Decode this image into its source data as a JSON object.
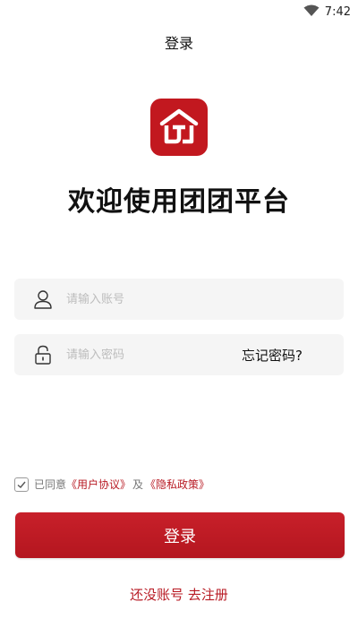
{
  "status_bar": {
    "time": "7:42",
    "icons": [
      "wifi-icon",
      "battery-icon"
    ]
  },
  "header": {
    "title": "登录"
  },
  "logo": {
    "icon": "house-logo-icon",
    "color": "#c2181f"
  },
  "welcome": {
    "title": "欢迎使用团团平台"
  },
  "form": {
    "account": {
      "placeholder": "请输入账号",
      "value": "",
      "icon": "user-icon"
    },
    "password": {
      "placeholder": "请输入密码",
      "value": "",
      "icon": "lock-icon"
    },
    "forgot_label": "忘记密码?"
  },
  "agreement": {
    "checked": true,
    "prefix": "已同意",
    "user_agreement": "《用户协议》",
    "and": "及",
    "privacy_policy": "《隐私政策》"
  },
  "login_button": {
    "label": "登录"
  },
  "register": {
    "label": "还没账号 去注册"
  },
  "colors": {
    "accent": "#b81b24",
    "field_bg": "#f5f5f5"
  }
}
